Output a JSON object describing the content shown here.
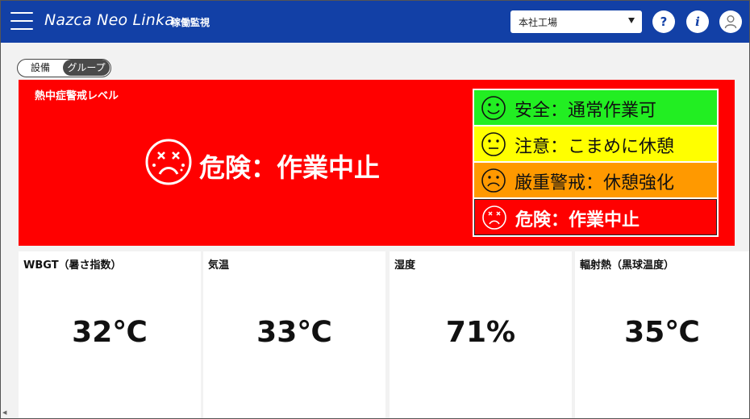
{
  "header": {
    "app_title": "Nazca Neo Linka",
    "page_title": "稼働監視",
    "site_select_value": "本社工場",
    "help_label": "?",
    "info_label": "i"
  },
  "toggle": {
    "option1": "設備",
    "option2": "グループ",
    "selected": "グループ"
  },
  "warning": {
    "title": "熱中症警戒レベル",
    "current_status": "危険：作業中止",
    "background_color": "#ff0000",
    "levels": [
      {
        "label": "安全：通常作業可",
        "color": "#22ee22",
        "face": "smile-icon"
      },
      {
        "label": "注意：こまめに休憩",
        "color": "#ffff00",
        "face": "neutral-icon"
      },
      {
        "label": "厳重警戒：休憩強化",
        "color": "#ff9900",
        "face": "frown-icon"
      },
      {
        "label": "危険：作業中止",
        "color": "#ff0000",
        "face": "dizzy-icon"
      }
    ]
  },
  "metrics": [
    {
      "label": "WBGT（暑さ指数）",
      "value": "32℃"
    },
    {
      "label": "気温",
      "value": "33℃"
    },
    {
      "label": "湿度",
      "value": "71%"
    },
    {
      "label": "輻射熱（黒球温度）",
      "value": "35℃"
    }
  ],
  "colors": {
    "header_bg": "#1240a6",
    "page_bg": "#f2f2f2"
  }
}
